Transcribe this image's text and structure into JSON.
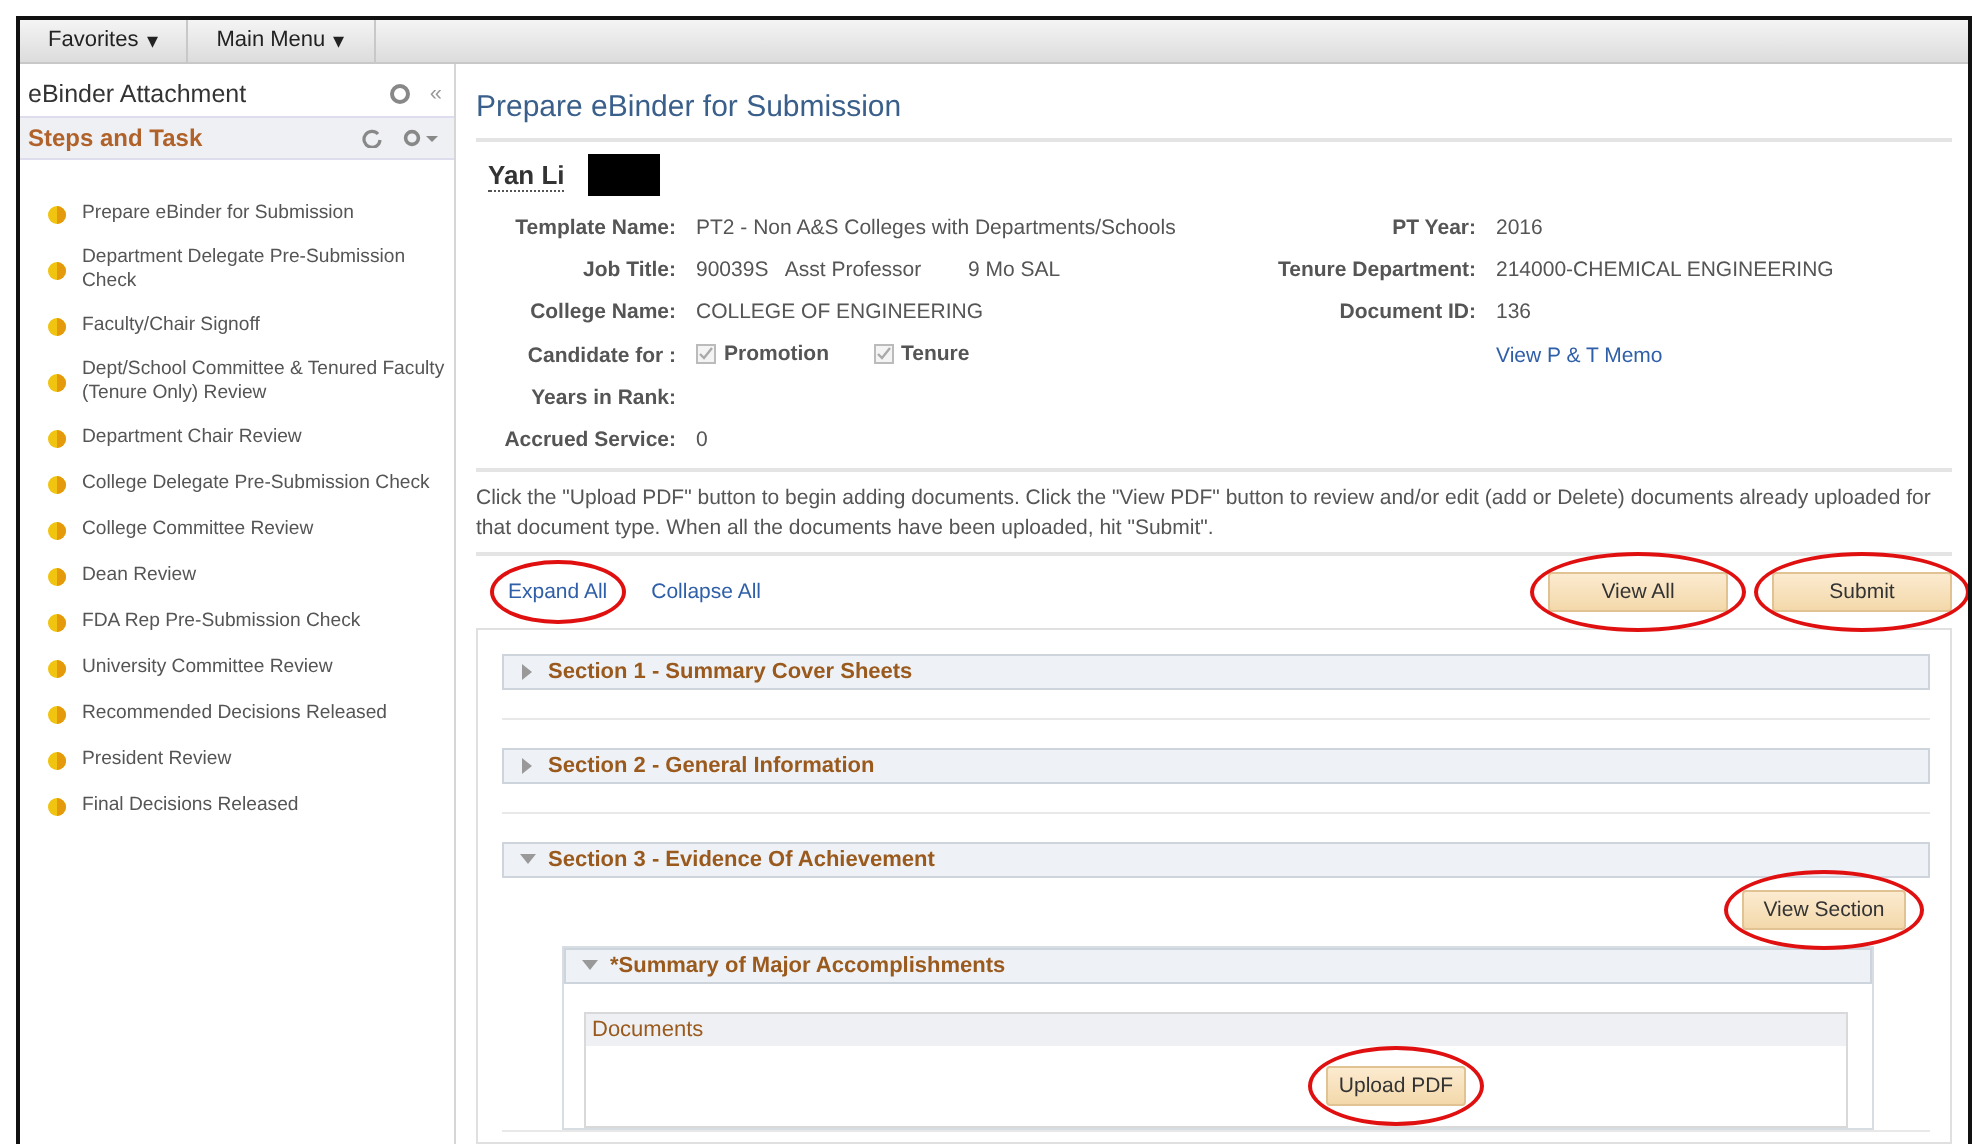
{
  "menu_bar": {
    "items": [
      {
        "label": "Favorites",
        "caret": "▾"
      },
      {
        "label": "Main Menu",
        "caret": "▾"
      }
    ]
  },
  "sidebar": {
    "title": "eBinder Attachment",
    "collapse": "«",
    "section_title": "Steps and Task",
    "items": [
      {
        "label": "Prepare eBinder for Submission"
      },
      {
        "label": "Department Delegate Pre-Submission Check"
      },
      {
        "label": "Faculty/Chair Signoff"
      },
      {
        "label": "Dept/School Committee & Tenured Faculty (Tenure Only) Review"
      },
      {
        "label": "Department Chair Review"
      },
      {
        "label": "College Delegate Pre-Submission Check"
      },
      {
        "label": "College Committee Review"
      },
      {
        "label": "Dean Review"
      },
      {
        "label": "FDA Rep Pre-Submission Check"
      },
      {
        "label": "University Committee Review"
      },
      {
        "label": "Recommended Decisions Released"
      },
      {
        "label": "President Review"
      },
      {
        "label": "Final Decisions Released"
      }
    ]
  },
  "page": {
    "title": "Prepare eBinder for Submission",
    "candidate_name": "Yan Li",
    "redacted": true,
    "left_fields": [
      {
        "label": "Template Name:",
        "value": "PT2 - Non A&S Colleges with Departments/Schools"
      },
      {
        "label": "Job Title:",
        "value": "90039S   Asst Professor        9 Mo SAL"
      },
      {
        "label": "College Name:",
        "value": "COLLEGE OF ENGINEERING"
      }
    ],
    "right_fields": [
      {
        "label": "PT Year:",
        "value": "2016"
      },
      {
        "label": "Tenure Department:",
        "value": "214000-CHEMICAL ENGINEERING"
      },
      {
        "label": "Document ID:",
        "value": "136"
      }
    ],
    "memo_link": "View P & T Memo",
    "candidate_for": {
      "label": "Candidate for :",
      "options": [
        {
          "label": "Promotion",
          "checked": true
        },
        {
          "label": "Tenure",
          "checked": true
        }
      ]
    },
    "lower_fields": [
      {
        "label": "Years in Rank:"
      },
      {
        "label": "Accrued Service:",
        "value": "0"
      }
    ],
    "instructions": "Click the \"Upload PDF\" button to begin adding documents. Click the \"View PDF\" button to review and/or edit (add or Delete) documents already uploaded for that document type. When all the documents have been uploaded, hit \"Submit\".",
    "links": [
      {
        "label": "Expand All",
        "circled": true
      },
      {
        "label": "Collapse All",
        "circled": false
      }
    ],
    "buttons": [
      {
        "label": "View All",
        "circled": true
      },
      {
        "label": "Submit",
        "circled": true
      }
    ],
    "sections": [
      {
        "title": "Section 1 - Summary Cover Sheets",
        "expanded": false
      },
      {
        "title": "Section 2 - General Information",
        "expanded": false
      },
      {
        "title": "Section 3 - Evidence Of Achievement",
        "expanded": true,
        "button": {
          "label": "View Section",
          "circled": true
        },
        "subsection": {
          "title": "*Summary of Major Accomplishments",
          "expanded": true,
          "box_title": "Documents",
          "button": {
            "label": "Upload PDF",
            "circled": true
          }
        }
      }
    ]
  }
}
